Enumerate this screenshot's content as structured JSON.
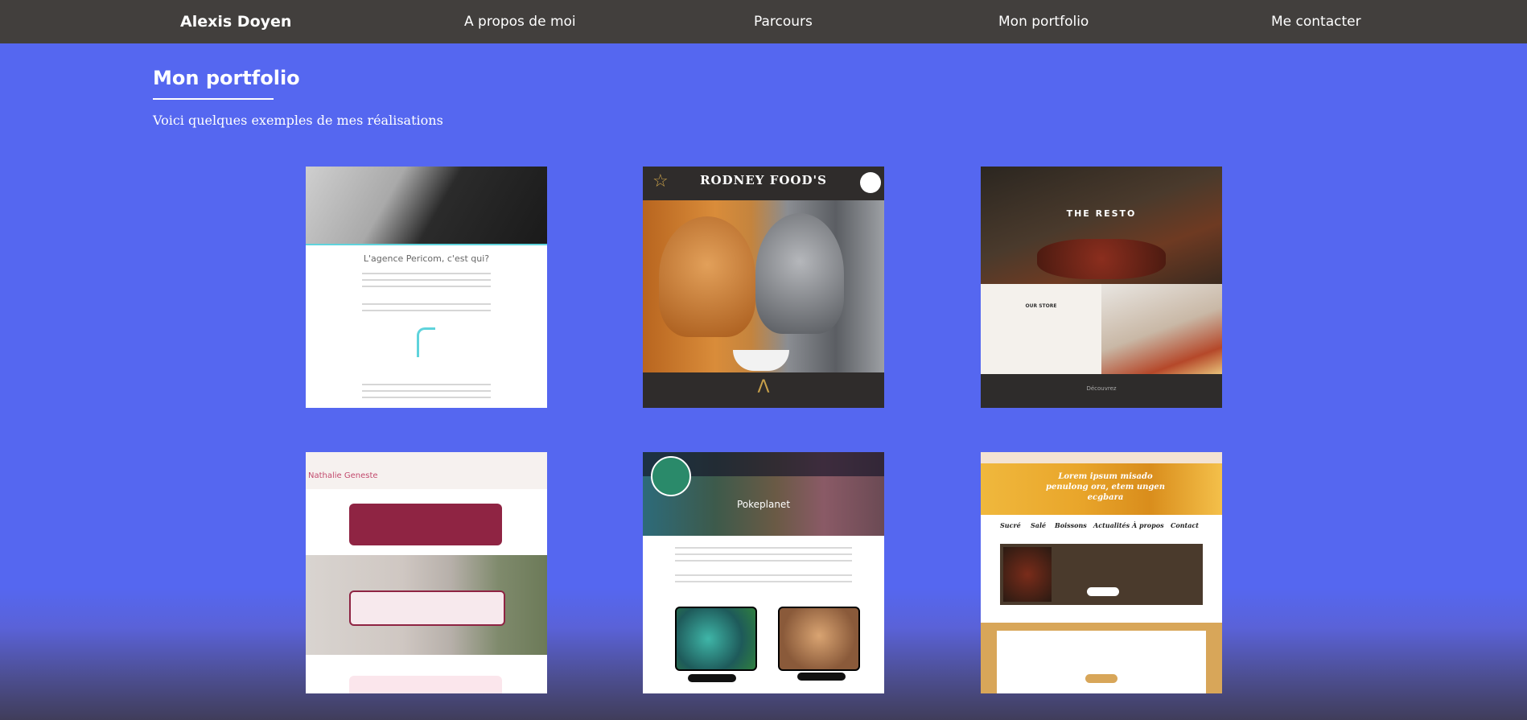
{
  "nav": {
    "brand": "Alexis Doyen",
    "items": [
      "A propos de moi",
      "Parcours",
      "Mon portfolio",
      "Me contacter"
    ]
  },
  "portfolio": {
    "title": "Mon portfolio",
    "subtitle": "Voici quelques exemples de mes réalisations",
    "projects": [
      {
        "heading": "L'agence Pericom, c'est qui?"
      },
      {
        "title": "RODNEY FOOD'S"
      },
      {
        "title": "THE RESTO",
        "store": "OUR STORE",
        "discover": "Découvrez"
      },
      {
        "name": "Nathalie Geneste"
      },
      {
        "title": "Pokeplanet"
      },
      {
        "hero": "Lorem ipsum misado penulong ora, etem ungen ecgbara",
        "menu": [
          "Sucré",
          "Salé",
          "Boissons",
          "Actualités",
          "À propos",
          "Contact"
        ]
      }
    ]
  },
  "colors": {
    "background": "#5567f0",
    "navbar": "#423f3d",
    "text": "#ffffff"
  }
}
